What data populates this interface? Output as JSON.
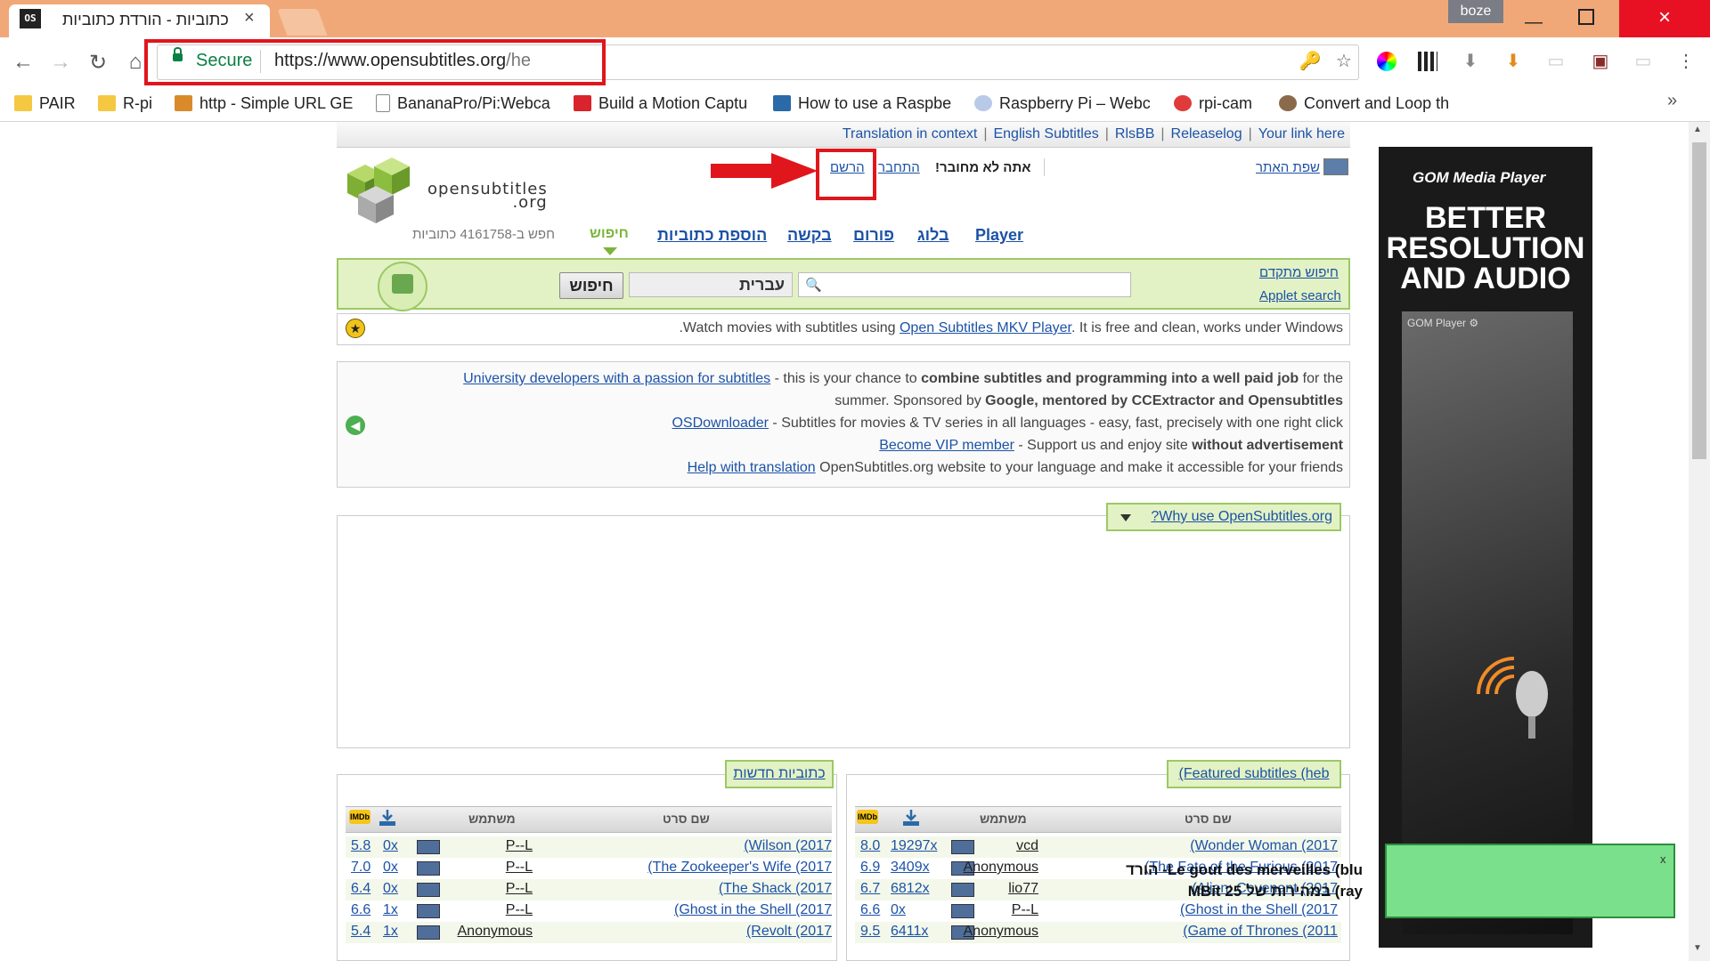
{
  "browser": {
    "tab_title": "כתוביות - הורדת כתוביות",
    "tab_favicon": "OS",
    "tab_close": "×",
    "user_badge": "boze",
    "window_close": "×",
    "secure_label": "Secure",
    "url_host": "https://www.opensubtitles.org",
    "url_path": "/he",
    "overflow_chevron": "»"
  },
  "bookmarks": [
    {
      "label": "PAIR",
      "icon": "folder-icon"
    },
    {
      "label": "R-pi",
      "icon": "folder-icon"
    },
    {
      "label": "http - Simple URL GE",
      "icon": "bookmark-icon"
    },
    {
      "label": "BananaPro/Pi:Webca",
      "icon": "page-icon"
    },
    {
      "label": "Build a Motion Captu",
      "icon": "bookmark-icon"
    },
    {
      "label": "How to use a Raspbe",
      "icon": "bookmark-icon"
    },
    {
      "label": "Raspberry Pi – Webc",
      "icon": "raspberry-icon"
    },
    {
      "label": "rpi-cam",
      "icon": "bookmark-icon"
    },
    {
      "label": "Convert and Loop th",
      "icon": "avatar-icon"
    }
  ],
  "site": {
    "toplinks": [
      "Translation in context",
      "English Subtitles",
      "RlsBB",
      "Releaselog",
      "Your link here"
    ],
    "logo_line1": "opensubtitles",
    "logo_line2": ".org",
    "site_language": "שפת האתר",
    "not_logged_in": "אתה לא מחובר!",
    "login": "התחבר",
    "register": "הרשם",
    "menu": {
      "search": "חיפוש",
      "upload": "הוספת כתוביות",
      "request": "בקשה",
      "forum": "פורום",
      "blog": "בלוג",
      "player": "Player"
    },
    "search_count": "חפש ב-4161758 כתוביות",
    "search_button": "חיפוש",
    "search_language": "עברית",
    "advanced_search": "חיפוש מתקדם",
    "applet_search": "Applet search",
    "mkv": {
      "prefix": ".Watch movies with subtitles using ",
      "link": "Open Subtitles MKV Player",
      "suffix": ". It is free and clean, works under Windows"
    },
    "info": {
      "line1_link": "University developers with a passion for subtitles",
      "line1_mid": " - this is your chance to ",
      "line1_bold": "combine subtitles and programming into a well paid job",
      "line1_end": " for the",
      "line2_start": "summer. Sponsored by ",
      "line2_bold": "Google, mentored by CCExtractor and Opensubtitles",
      "line3_link": "OSDownloader",
      "line3_rest": " - Subtitles for movies & TV series in all languages - easy, fast, precisely with one right click",
      "line4_link": "Become VIP member",
      "line4_rest": " - Support us and enjoy site ",
      "line4_bold": "without advertisement",
      "line5_link": "Help with translation",
      "line5_rest": " OpenSubtitles.org website to your language and make it accessible for your friends"
    },
    "why_use": "?Why use OpenSubtitles.org",
    "new_subtitles_btn": "כתוביות חדשות",
    "featured_btn": "(Featured subtitles (heb",
    "col_movie": "שם סרט",
    "col_user": "משתמש",
    "imdb_label": "IMDb"
  },
  "new_subtitles": [
    {
      "movie": "(Wilson (2017",
      "user": "P--L",
      "downloads": "0x",
      "rating": "5.8"
    },
    {
      "movie": "(The Zookeeper's Wife (2017",
      "user": "P--L",
      "downloads": "0x",
      "rating": "7.0"
    },
    {
      "movie": "(The Shack (2017",
      "user": "P--L",
      "downloads": "0x",
      "rating": "6.4"
    },
    {
      "movie": "(Ghost in the Shell (2017",
      "user": "P--L",
      "downloads": "1x",
      "rating": "6.6"
    },
    {
      "movie": "(Revolt (2017",
      "user": "Anonymous",
      "downloads": "1x",
      "rating": "5.4"
    }
  ],
  "featured_subtitles": [
    {
      "movie": "(Wonder Woman (2017",
      "user": "vcd",
      "downloads": "19297x",
      "rating": "8.0"
    },
    {
      "movie": "(The Fate of the Furious (2017",
      "user": "Anonymous",
      "downloads": "3409x",
      "rating": "6.9"
    },
    {
      "movie": "(Alien: Covenant (2017",
      "user": "lio77",
      "downloads": "6812x",
      "rating": "6.7"
    },
    {
      "movie": "(Ghost in the Shell (2017",
      "user": "P--L",
      "downloads": "0x",
      "rating": "6.6"
    },
    {
      "movie": "(Game of Thrones (2011",
      "user": "Anonymous",
      "downloads": "6411x",
      "rating": "9.5"
    }
  ],
  "ad": {
    "brand": "GOM Media Player",
    "headline": "BETTER RESOLUTION AND AUDIO",
    "photo_label": "GOM Player ⚙",
    "popup_line1": "Le gout des merveilles (blu- הורד",
    "popup_line2": "ray) במהירות של 25 MBit",
    "popup_close": "x"
  },
  "colors": {
    "titlebar": "#f1a878",
    "link": "#1c52a6",
    "green_bar": "#e2f2c4",
    "highlight_red": "#e0161c"
  }
}
